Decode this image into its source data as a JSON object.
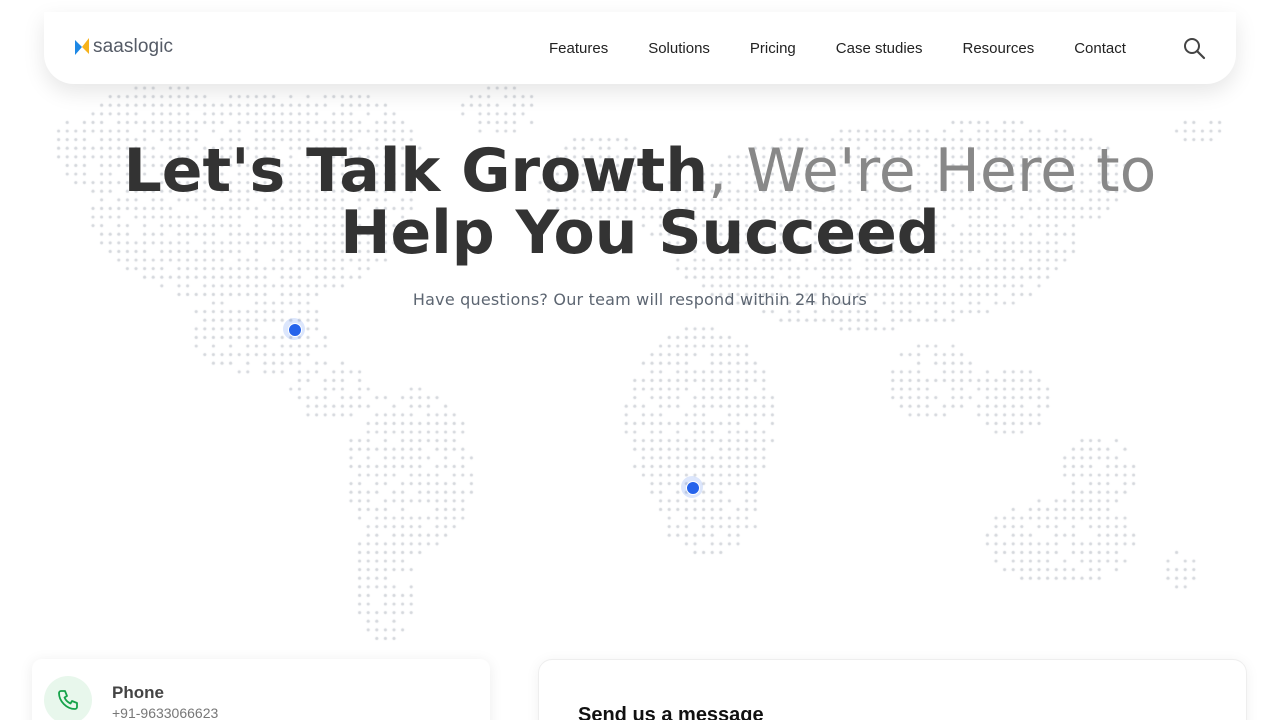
{
  "brand": {
    "name": "saaslogic"
  },
  "nav": {
    "items": [
      {
        "label": "Features"
      },
      {
        "label": "Solutions"
      },
      {
        "label": "Pricing"
      },
      {
        "label": "Case studies"
      },
      {
        "label": "Resources"
      },
      {
        "label": "Contact"
      }
    ],
    "search_icon": "search-icon"
  },
  "hero": {
    "headline_bold_1": "Let's Talk Growth",
    "headline_light": ", We're Here to",
    "headline_bold_2": "Help You Succeed",
    "subtitle": "Have questions? Our team will respond within 24 hours"
  },
  "contact_card": {
    "label": "Phone",
    "value": "+91-9633066623",
    "icon": "phone-icon"
  },
  "message_card": {
    "title": "Send us a message"
  },
  "colors": {
    "marker": "#2563eb",
    "heading": "#333333",
    "heading_light": "#888888",
    "phone_icon": "#16a34a",
    "logo_yellow": "#f6b21b",
    "logo_blue": "#1e88e5",
    "map_dots": "#d3d6db"
  }
}
